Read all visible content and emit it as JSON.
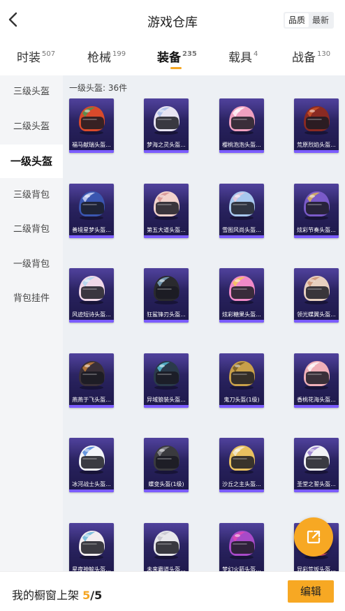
{
  "header": {
    "title": "游戏仓库",
    "sort_options": [
      "品质",
      "最新"
    ],
    "active_sort": "品质"
  },
  "tabs": [
    {
      "label": "时装",
      "count": "507"
    },
    {
      "label": "枪械",
      "count": "199"
    },
    {
      "label": "装备",
      "count": "235",
      "active": true
    },
    {
      "label": "载具",
      "count": "4"
    },
    {
      "label": "战备",
      "count": "130"
    }
  ],
  "sidebar": {
    "items": [
      {
        "label": "三级头盔"
      },
      {
        "label": "二级头盔"
      },
      {
        "label": "一级头盔",
        "active": true
      },
      {
        "label": "三级背包"
      },
      {
        "label": "二级背包"
      },
      {
        "label": "一级背包"
      },
      {
        "label": "背包挂件"
      }
    ]
  },
  "section": {
    "label": "一级头盔: 36件"
  },
  "items": [
    {
      "name": "福马献瑞头盔...",
      "color": "#d94a2b",
      "accent": "#3aa05a"
    },
    {
      "name": "梦海之灵头盔...",
      "color": "#e8e4f2",
      "accent": "#9db7e8"
    },
    {
      "name": "樱桃泡泡头盔...",
      "color": "#f0a0c0",
      "accent": "#ffffff"
    },
    {
      "name": "荒原烈焰头盔...",
      "color": "#8a2a22",
      "accent": "#d45a2a"
    },
    {
      "name": "善境星梦头盔...",
      "color": "#3a56b0",
      "accent": "#e0e6ff"
    },
    {
      "name": "第五大道头盔...",
      "color": "#f2d2cc",
      "accent": "#d08a8a"
    },
    {
      "name": "雪图风尚头盔...",
      "color": "#a8c8ee",
      "accent": "#f0c8d8"
    },
    {
      "name": "炫彩节奏头盔...",
      "color": "#7a5ac8",
      "accent": "#e8c24a"
    },
    {
      "name": "风迹短诗头盔...",
      "color": "#f0d8e8",
      "accent": "#a8d8f0"
    },
    {
      "name": "狂鲨锋刃头盔...",
      "color": "#2a2a2e",
      "accent": "#8ab8d8"
    },
    {
      "name": "炫彩糖果头盔...",
      "color": "#f08ac8",
      "accent": "#f5d24a"
    },
    {
      "name": "领光蝶翼头盔...",
      "color": "#e8d0c0",
      "accent": "#c88a6a"
    },
    {
      "name": "燕燕于飞头盔...",
      "color": "#3a3038",
      "accent": "#d88a3a"
    },
    {
      "name": "异域狼装头盔...",
      "color": "#2a3a4a",
      "accent": "#5ad0e8"
    },
    {
      "name": "鬼刀头盔(1级)",
      "color": "#c8a04a",
      "accent": "#6a5020"
    },
    {
      "name": "香桃花海头盔...",
      "color": "#f0b0b8",
      "accent": "#ffffff"
    },
    {
      "name": "冰河战士头盔...",
      "color": "#f2f4f8",
      "accent": "#3a7ad8"
    },
    {
      "name": "蝶变头盔(1级)",
      "color": "#3a3a3e",
      "accent": "#9a9aa0"
    },
    {
      "name": "沙丘之主头盔...",
      "color": "#e8c060",
      "accent": "#f5f0e0"
    },
    {
      "name": "圣堂之誓头盔...",
      "color": "#f2f2f6",
      "accent": "#8a6ac8"
    },
    {
      "name": "星夜神鲸头盔...",
      "color": "#f4eef0",
      "accent": "#5ab0d8"
    },
    {
      "name": "未来霸道头盔...",
      "color": "#e8e8ec",
      "accent": "#c0c0c8"
    },
    {
      "name": "梦幻火箭头盔...",
      "color": "#a84ac8",
      "accent": "#e84ab0"
    },
    {
      "name": "异彩荒坂头盔...",
      "color": "#d84a6a",
      "accent": "#f0c0a0"
    }
  ],
  "footer": {
    "label": "我的橱窗上架",
    "current": "5",
    "separator": "/",
    "total": "5",
    "edit_label": "编辑"
  },
  "colors": {
    "accent": "#f7a823",
    "card_bg": "#26205a"
  }
}
